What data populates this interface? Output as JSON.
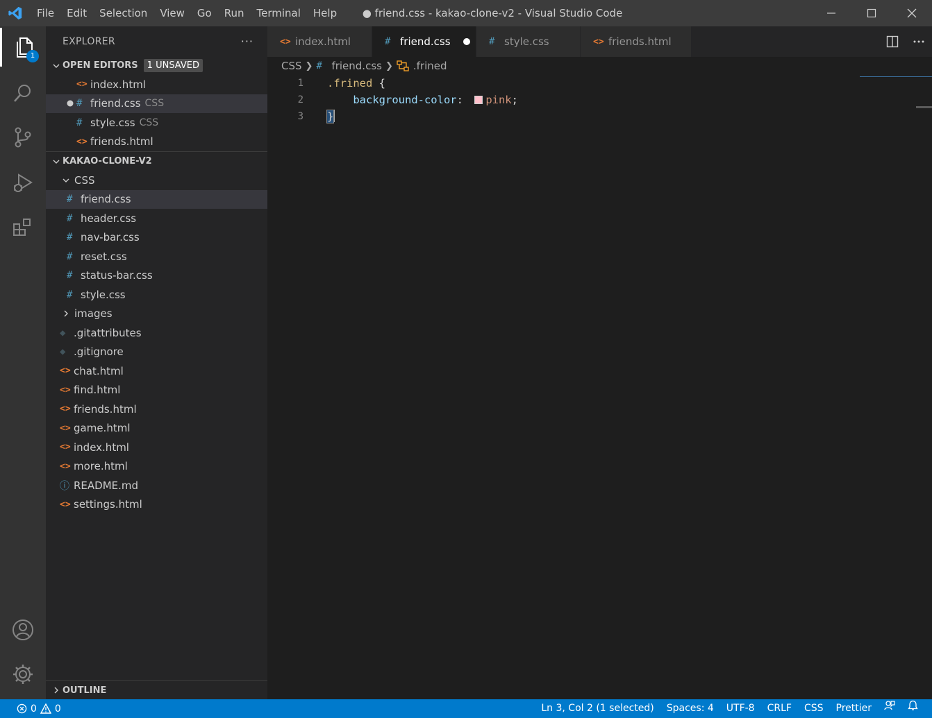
{
  "window": {
    "title": "● friend.css - kakao-clone-v2 - Visual Studio Code"
  },
  "menu": [
    "File",
    "Edit",
    "Selection",
    "View",
    "Go",
    "Run",
    "Terminal",
    "Help"
  ],
  "activity": {
    "explorer_badge": "1"
  },
  "sidebar": {
    "title": "EXPLORER",
    "more": "···",
    "open_editors": {
      "label": "OPEN EDITORS",
      "badge": "1 UNSAVED",
      "items": [
        {
          "name": "index.html",
          "desc": "",
          "type": "html"
        },
        {
          "name": "friend.css",
          "desc": "CSS",
          "type": "css"
        },
        {
          "name": "style.css",
          "desc": "CSS",
          "type": "css"
        },
        {
          "name": "friends.html",
          "desc": "",
          "type": "html"
        }
      ]
    },
    "project": {
      "label": "KAKAO-CLONE-V2",
      "css_folder": "CSS",
      "css_files": [
        "friend.css",
        "header.css",
        "nav-bar.css",
        "reset.css",
        "status-bar.css",
        "style.css"
      ],
      "images_folder": "images",
      "files": [
        {
          "name": ".gitattributes",
          "type": "git"
        },
        {
          "name": ".gitignore",
          "type": "git"
        },
        {
          "name": "chat.html",
          "type": "html"
        },
        {
          "name": "find.html",
          "type": "html"
        },
        {
          "name": "friends.html",
          "type": "html"
        },
        {
          "name": "game.html",
          "type": "html"
        },
        {
          "name": "index.html",
          "type": "html"
        },
        {
          "name": "more.html",
          "type": "html"
        },
        {
          "name": "README.md",
          "type": "info"
        },
        {
          "name": "settings.html",
          "type": "html"
        }
      ]
    },
    "outline": "OUTLINE"
  },
  "tabs": [
    {
      "name": "index.html",
      "type": "html"
    },
    {
      "name": "friend.css",
      "type": "css"
    },
    {
      "name": "style.css",
      "type": "css"
    },
    {
      "name": "friends.html",
      "type": "html"
    }
  ],
  "breadcrumb": {
    "folder": "CSS",
    "file": "friend.css",
    "symbol": ".frined"
  },
  "editor": {
    "line_numbers": [
      "1",
      "2",
      "3"
    ],
    "selector": ".frined",
    "open_brace": " {",
    "indent": "    ",
    "property": "background-color",
    "colon": ": ",
    "value": "pink",
    "semicolon": ";",
    "close_brace": "}",
    "swatch_color": "#ffc0cb"
  },
  "status": {
    "errors": "0",
    "warnings": "0",
    "position": "Ln 3, Col 2 (1 selected)",
    "spaces": "Spaces: 4",
    "encoding": "UTF-8",
    "eol": "CRLF",
    "language": "CSS",
    "formatter": "Prettier"
  },
  "colors": {
    "accent": "#007acc",
    "css_icon": "#519aba",
    "html_icon": "#e37933"
  }
}
